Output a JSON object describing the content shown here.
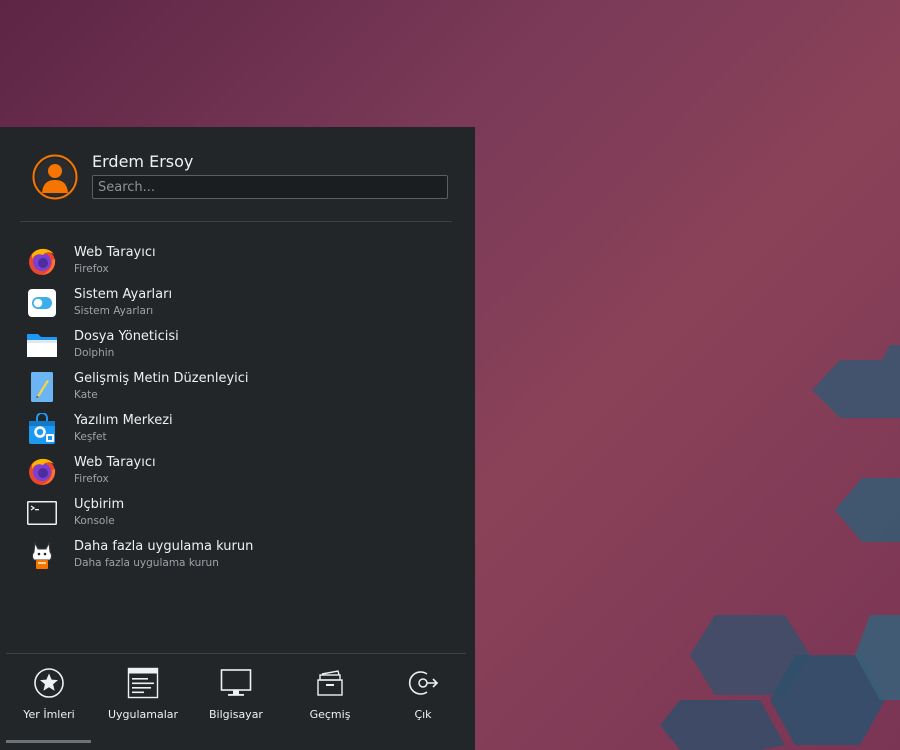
{
  "colors": {
    "panel_bg": "#232629",
    "accent": "#3daee9",
    "avatar": "#f67400"
  },
  "user": {
    "name": "Erdem Ersoy",
    "avatar_icon": "user-avatar-icon"
  },
  "search": {
    "placeholder": "Search..."
  },
  "apps": [
    {
      "name": "Web Tarayıcı",
      "sub": "Firefox",
      "icon": "firefox-icon"
    },
    {
      "name": "Sistem Ayarları",
      "sub": "Sistem Ayarları",
      "icon": "settings-icon"
    },
    {
      "name": "Dosya Yöneticisi",
      "sub": "Dolphin",
      "icon": "folder-icon"
    },
    {
      "name": "Gelişmiş Metin Düzenleyici",
      "sub": "Kate",
      "icon": "text-editor-icon"
    },
    {
      "name": "Yazılım Merkezi",
      "sub": "Keşfet",
      "icon": "software-store-icon"
    },
    {
      "name": "Web Tarayıcı",
      "sub": "Firefox",
      "icon": "firefox-icon"
    },
    {
      "name": "Uçbirim",
      "sub": "Konsole",
      "icon": "terminal-icon"
    },
    {
      "name": "Daha fazla uygulama kurun",
      "sub": "Daha fazla uygulama kurun",
      "icon": "more-apps-icon"
    }
  ],
  "tabs": [
    {
      "label": "Yer İmleri",
      "icon": "star-icon"
    },
    {
      "label": "Uygulamalar",
      "icon": "applications-icon"
    },
    {
      "label": "Bilgisayar",
      "icon": "computer-icon"
    },
    {
      "label": "Geçmiş",
      "icon": "history-icon"
    },
    {
      "label": "Çık",
      "icon": "logout-icon"
    }
  ]
}
